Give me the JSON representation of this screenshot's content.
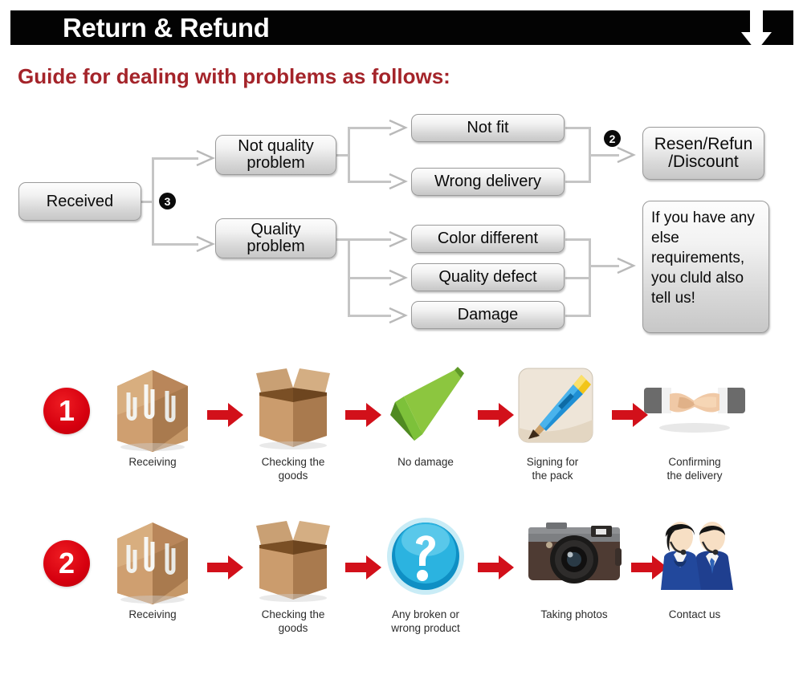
{
  "banner": {
    "title": "Return & Refund",
    "arrow_icon": "down-arrow-icon",
    "background_color": "#030303",
    "text_color": "#ffffff"
  },
  "guide": {
    "heading": "Guide for dealing with problems as follows:",
    "heading_color": "#a4242a"
  },
  "flowchart": {
    "nodes": {
      "received": "Received",
      "not_quality_problem": "Not quality\nproblem",
      "quality_problem": "Quality\nproblem",
      "not_fit": "Not fit",
      "wrong_delivery": "Wrong delivery",
      "color_different": "Color different",
      "quality_defect": "Quality defect",
      "damage": "Damage",
      "resend_refund_discount": "Resen/Refun\n/Discount",
      "else_requirements": "If you have any else requirements, you cluld also tell us!"
    },
    "badges": {
      "branch_badge": "3",
      "outcome_badge": "2"
    }
  },
  "steps": {
    "rows": [
      {
        "number": "1",
        "cells": [
          {
            "icon": "sealed-box-icon",
            "caption": "Receiving"
          },
          {
            "icon": "open-box-icon",
            "caption": "Checking the\ngoods"
          },
          {
            "icon": "green-check-icon",
            "caption": "No damage"
          },
          {
            "icon": "pencil-signing-icon",
            "caption": "Signing for\nthe pack"
          },
          {
            "icon": "handshake-icon",
            "caption": "Confirming\nthe delivery"
          }
        ]
      },
      {
        "number": "2",
        "cells": [
          {
            "icon": "sealed-box-icon",
            "caption": "Receiving"
          },
          {
            "icon": "open-box-icon",
            "caption": "Checking the\ngoods"
          },
          {
            "icon": "blue-question-icon",
            "caption": "Any broken or\nwrong product"
          },
          {
            "icon": "camera-icon",
            "caption": "Taking photos"
          },
          {
            "icon": "support-agents-icon",
            "caption": "Contact us"
          }
        ]
      }
    ],
    "arrow_icon": "red-right-arrow-icon",
    "arrow_color": "#d2101a",
    "number_badge_color": "#d6000f"
  }
}
